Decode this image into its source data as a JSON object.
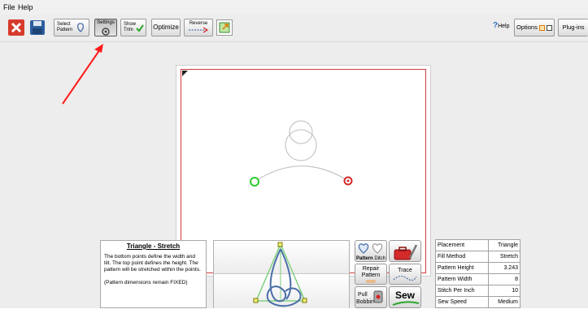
{
  "menu": {
    "file": "File",
    "help": "Help"
  },
  "toolbar": {
    "select_pattern": [
      "Select",
      "Pattern"
    ],
    "settings": "Settings",
    "show_trim": [
      "Show",
      "Trim"
    ],
    "optimize": "Optimize",
    "reverse": "Reverse",
    "help": "Help",
    "options": "Options",
    "plugins": "Plug-ins"
  },
  "description": {
    "title": "Triangle - Stretch",
    "body": "The bottom points define the width and tilt. The top point defines the height. The pattern will be stretched within the points.",
    "note": "(Pattern dimensions remain FIXED)"
  },
  "side_buttons": {
    "pattern": "Pattern",
    "ditch": "Ditch",
    "repair": [
      "Repair",
      "Pattern"
    ],
    "trace": "Trace",
    "pull_bobbin": [
      "Pull",
      "Bobbin"
    ],
    "sew": "Sew"
  },
  "properties": [
    {
      "label": "Placement",
      "value": "Triangle"
    },
    {
      "label": "Fill Method",
      "value": "Stretch"
    },
    {
      "label": "Pattern Height",
      "value": "3.243"
    },
    {
      "label": "Pattern Width",
      "value": "8"
    },
    {
      "label": "Stitch Per Inch",
      "value": "10"
    },
    {
      "label": "Sew Speed",
      "value": "Medium"
    }
  ],
  "colors": {
    "border_red": "#d23a3a",
    "start_point": "#2ecc2e",
    "end_point": "#d22a2a",
    "arrow": "#ff1a1a",
    "triangle": "#7fd07f",
    "knot": "#4a6ea8"
  }
}
